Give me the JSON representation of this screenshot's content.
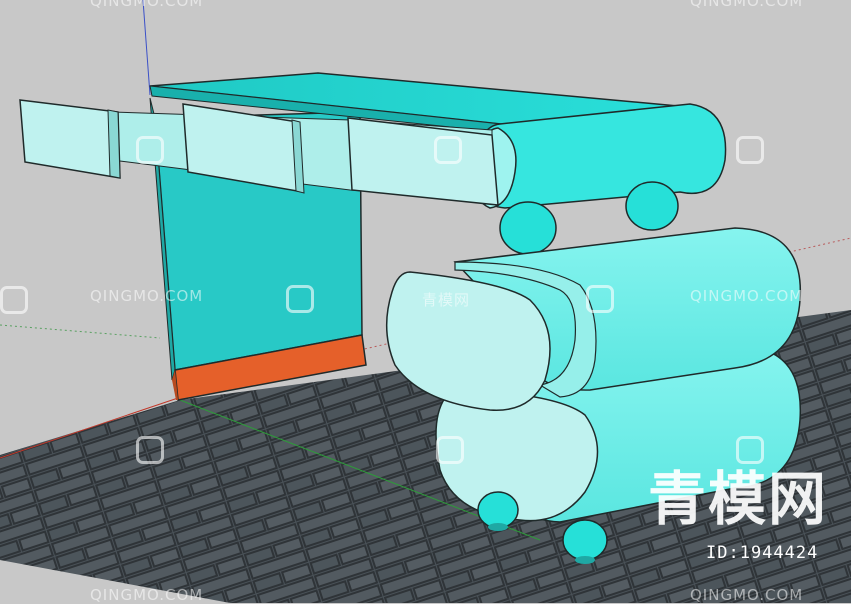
{
  "watermark": {
    "site": "QINGMO.COM",
    "site_cn": "青模网",
    "id_text": "ID:1944424"
  },
  "colors": {
    "background": "#c8c8c8",
    "floor_tile": "#4a5258",
    "grout": "#2f3438",
    "desk_top": "#23d4cf",
    "desk_leg": "#28c9c6",
    "leg_base": "#e5602a",
    "drawer_face": "#bff2ef",
    "cabinet_body": "#6feee8",
    "foot": "#26e0d8",
    "outline": "#1f2a2a"
  },
  "icons": [
    "qingmo-logo-icon"
  ]
}
